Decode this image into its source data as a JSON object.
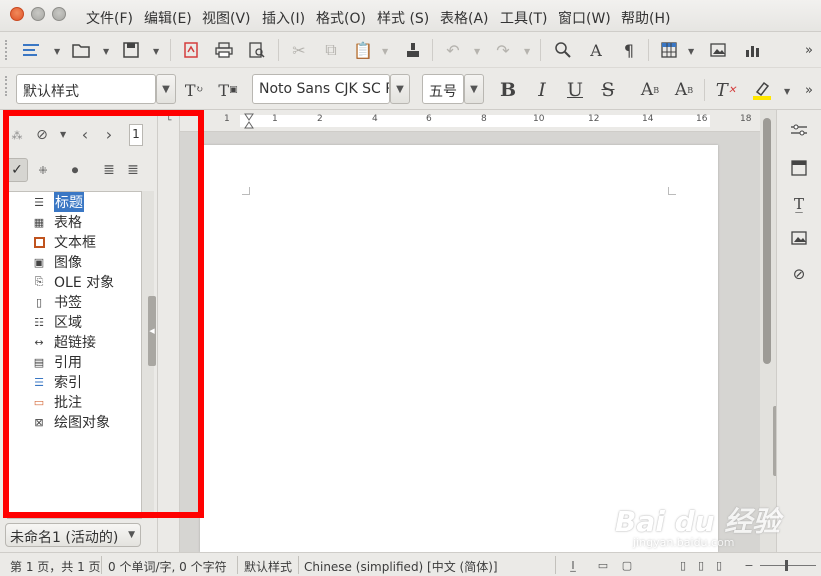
{
  "menubar": {
    "items": [
      "文件(F)",
      "编辑(E)",
      "视图(V)",
      "插入(I)",
      "格式(O)",
      "样式 (S)",
      "表格(A)",
      "工具(T)",
      "窗口(W)",
      "帮助(H)"
    ]
  },
  "formatting": {
    "paragraph_style": "默认样式",
    "font_name": "Noto Sans CJK SC R",
    "font_size": "五号"
  },
  "navigator": {
    "page_number": "1",
    "items": [
      {
        "label": "标题",
        "icon": "heading-icon",
        "selected": true
      },
      {
        "label": "表格",
        "icon": "table-icon"
      },
      {
        "label": "文本框",
        "icon": "frame-icon"
      },
      {
        "label": "图像",
        "icon": "image-icon"
      },
      {
        "label": "OLE 对象",
        "icon": "ole-object-icon"
      },
      {
        "label": "书签",
        "icon": "bookmark-icon"
      },
      {
        "label": "区域",
        "icon": "section-icon"
      },
      {
        "label": "超链接",
        "icon": "hyperlink-icon"
      },
      {
        "label": "引用",
        "icon": "reference-icon"
      },
      {
        "label": "索引",
        "icon": "index-icon"
      },
      {
        "label": "批注",
        "icon": "comment-icon"
      },
      {
        "label": "绘图对象",
        "icon": "drawing-object-icon"
      }
    ],
    "document_select": "未命名1 (活动的)"
  },
  "ruler": {
    "labels": [
      "1",
      "1",
      "2",
      "4",
      "6",
      "8",
      "10",
      "12",
      "14",
      "16",
      "18"
    ]
  },
  "statusbar": {
    "page": "第 1 页，共 1 页",
    "word_count": "0 个单词/字, 0 个字符",
    "page_style": "默认样式",
    "language": "Chinese (simplified) [中文 (简体)]"
  },
  "watermark": {
    "main": "Bai du 经验",
    "sub": "jingyan.baidu.com"
  },
  "colors": {
    "highlight": "#ff0000",
    "selection": "#3a77c4",
    "close_button": "#e0542a"
  }
}
